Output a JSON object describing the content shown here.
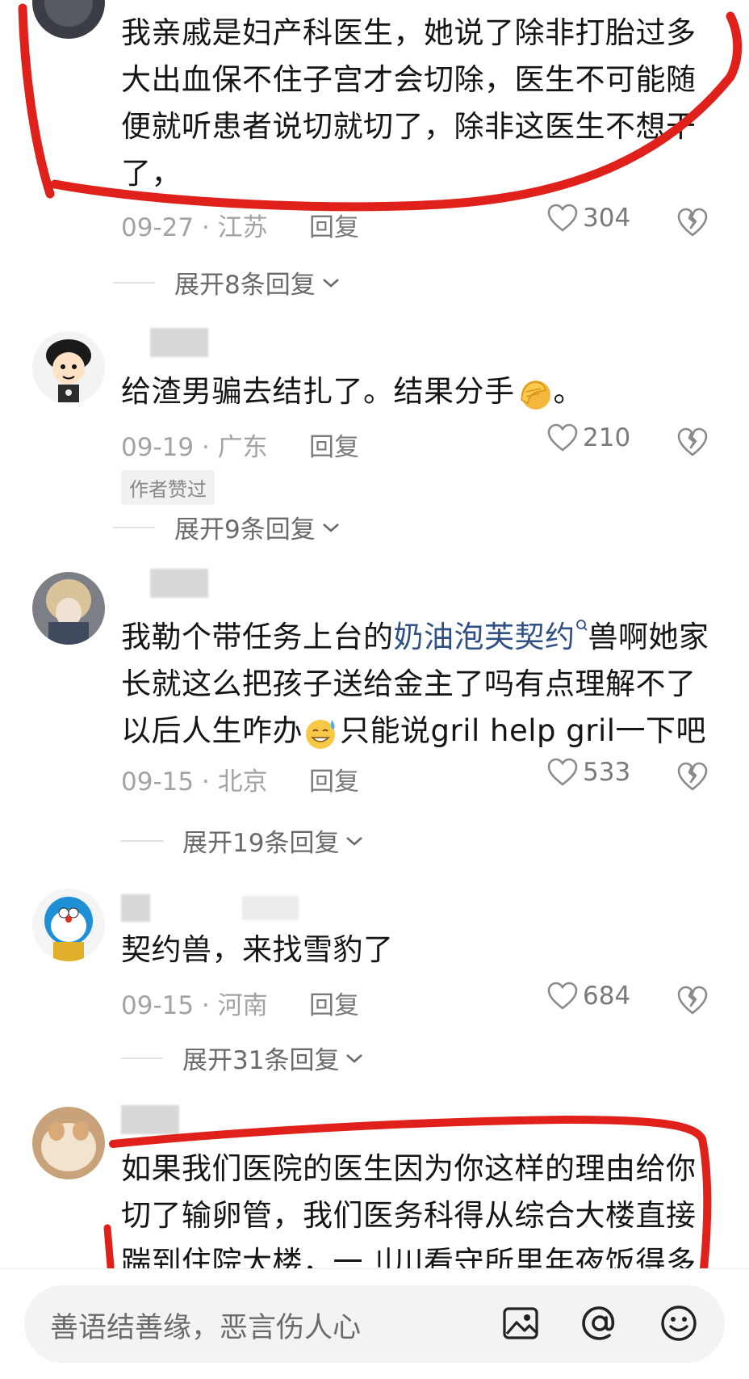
{
  "comments": [
    {
      "text": "我亲戚是妇产科医生，她说了除非打胎过多大出血保不住子宫才会切除，医生不可能随便就听患者说切就切了，除非这医生不想干了，",
      "date_loc": "09-27 · 江苏",
      "reply_label": "回复",
      "likes": "304",
      "expand_label": "展开8条回复"
    },
    {
      "text": "给渣男骗去结扎了。结果分手",
      "text_end": "。",
      "date_loc": "09-19 · 广东",
      "reply_label": "回复",
      "likes": "210",
      "badge": "作者赞过",
      "expand_label": "展开9条回复"
    },
    {
      "text_a": "我勒个带任务上台的",
      "link": "奶油泡芙契约",
      "text_b": "兽啊她家长就这么把孩子送给金主了吗有点理解不了以后人生咋办",
      "text_c": "只能说gril help gril一下吧",
      "date_loc": "09-15 · 北京",
      "reply_label": "回复",
      "likes": "533",
      "expand_label": "展开19条回复"
    },
    {
      "text": "契约兽，来找雪豹了",
      "date_loc": "09-15 · 河南",
      "reply_label": "回复",
      "likes": "684",
      "expand_label": "展开31条回复"
    },
    {
      "text": "如果我们医院的医生因为你这样的理由给你切了输卵管，我们医务科得从综合大楼直接踹到住院大楼，一刂川看守所里年夜饭得多加"
    }
  ],
  "input": {
    "placeholder": "善语结善缘，恶言伤人心"
  },
  "icons": {
    "image": "image-icon",
    "at": "at-icon",
    "emoji": "emoji-icon"
  },
  "colors": {
    "annotation_red": "#e0201a",
    "link_blue": "#2f4f85"
  }
}
